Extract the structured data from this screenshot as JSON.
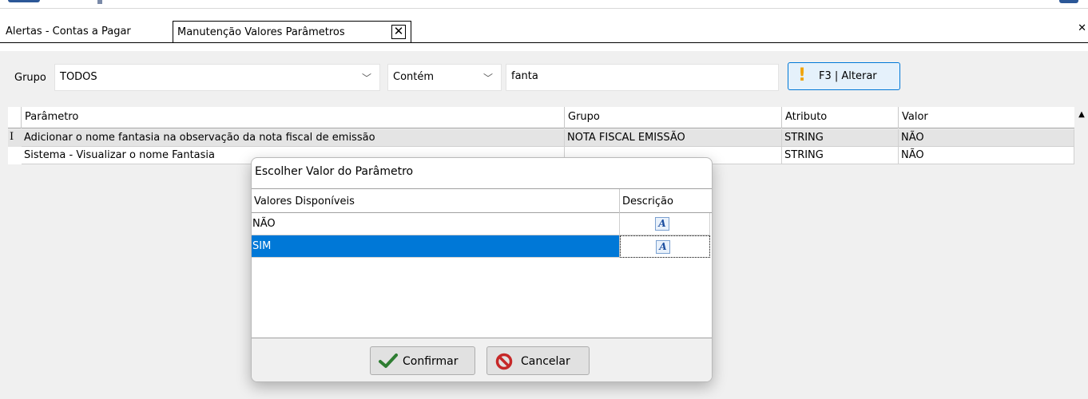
{
  "tabs": {
    "inactive_label": "Alertas - Contas a Pagar",
    "active_label": "Manutenção Valores Parâmetros",
    "close_glyph": "✕",
    "window_close_glyph": "✕"
  },
  "filter": {
    "grupo_label": "Grupo",
    "grupo_value": "TODOS",
    "condition_value": "Contém",
    "search_value": "fanta",
    "alterar_label": "F3 | Alterar",
    "alterar_icon": "exclamation-icon",
    "chevron_glyph": "﹀"
  },
  "grid": {
    "headers": {
      "parametro": "Parâmetro",
      "grupo": "Grupo",
      "atributo": "Atributo",
      "valor": "Valor"
    },
    "row_indicator": "I",
    "rows": [
      {
        "parametro": "Adicionar o nome fantasia na observação da nota fiscal de emissão",
        "grupo": "NOTA FISCAL EMISSÃO",
        "atributo": "STRING",
        "valor": "NÃO"
      },
      {
        "parametro": "Sistema - Visualizar o nome Fantasia",
        "grupo": "",
        "atributo": "STRING",
        "valor": "NÃO"
      }
    ],
    "scroll_glyph": "▲"
  },
  "dialog": {
    "title": "Escolher Valor do Parâmetro",
    "headers": {
      "valores": "Valores Disponíveis",
      "descricao": "Descrição"
    },
    "rows": [
      {
        "valor": "NÃO",
        "icon": "text-a-icon",
        "selected": false
      },
      {
        "valor": "SIM",
        "icon": "text-a-icon",
        "selected": true
      }
    ],
    "icon_glyph": "A",
    "confirm_label": "Confirmar",
    "cancel_label": "Cancelar"
  },
  "colors": {
    "selection": "#0078d7",
    "confirm_check": "#2e7d32",
    "cancel_icon": "#c62828",
    "alert_icon": "#f0a30a"
  }
}
